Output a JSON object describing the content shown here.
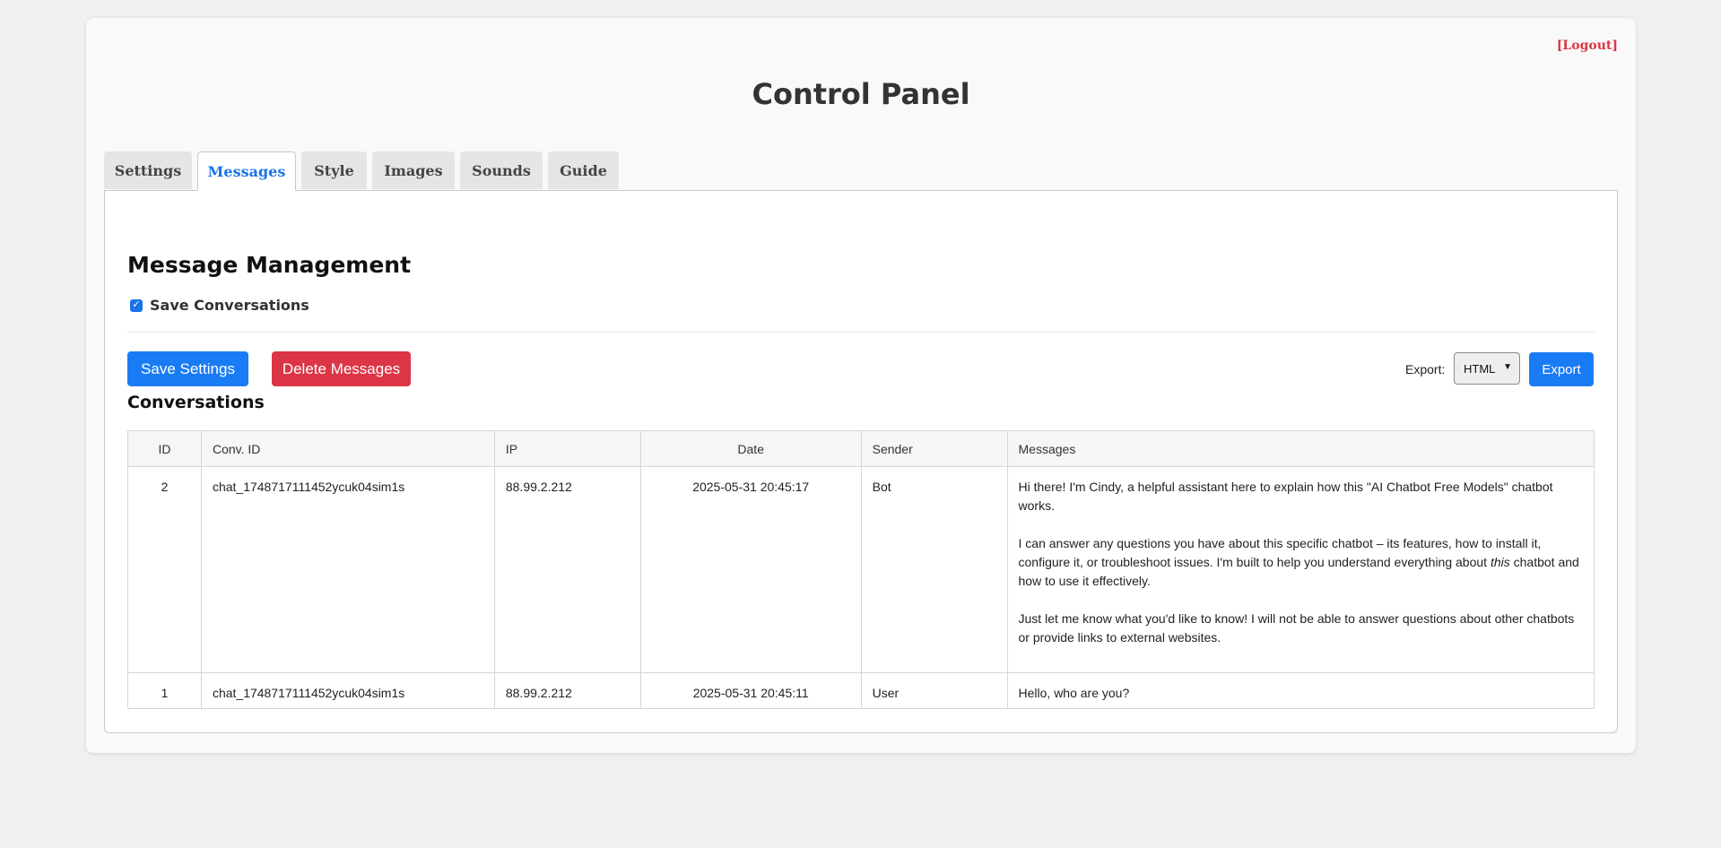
{
  "header": {
    "logout": "[Logout]",
    "title": "Control Panel"
  },
  "tabs": [
    {
      "label": "Settings",
      "active": false
    },
    {
      "label": "Messages",
      "active": true
    },
    {
      "label": "Style",
      "active": false
    },
    {
      "label": "Images",
      "active": false
    },
    {
      "label": "Sounds",
      "active": false
    },
    {
      "label": "Guide",
      "active": false
    }
  ],
  "section": {
    "title": "Message Management",
    "save_conversations_label": "Save Conversations",
    "save_conversations_checked": true
  },
  "actions": {
    "save_label": "Save Settings",
    "delete_label": "Delete Messages",
    "export_label": "Export:",
    "export_format": "HTML",
    "export_button": "Export"
  },
  "conversations": {
    "title": "Conversations",
    "columns": [
      "ID",
      "Conv. ID",
      "IP",
      "Date",
      "Sender",
      "Messages"
    ],
    "rows": [
      {
        "id": "2",
        "conv_id": "chat_1748717111452ycuk04sim1s",
        "ip": "88.99.2.212",
        "date": "2025-05-31 20:45:17",
        "sender": "Bot",
        "message_p1": "Hi there! I'm Cindy, a helpful assistant here to explain how this \"AI Chatbot Free Models\" chatbot works.",
        "message_p2_before": "I can answer any questions you have about this specific chatbot – its features, how to install it, configure it, or troubleshoot issues. I'm built to help you understand everything about ",
        "message_p2_em": "this",
        "message_p2_after": " chatbot and how to use it effectively.",
        "message_p3": "Just let me know what you'd like to know! I will not be able to answer questions about other chatbots or provide links to external websites."
      },
      {
        "id": "1",
        "conv_id": "chat_1748717111452ycuk04sim1s",
        "ip": "88.99.2.212",
        "date": "2025-05-31 20:45:11",
        "sender": "User",
        "message": "Hello, who are you?"
      }
    ]
  },
  "colors": {
    "accent": "#1a7cf5",
    "danger": "#dc3545",
    "active_tab": "#1a73e8"
  }
}
